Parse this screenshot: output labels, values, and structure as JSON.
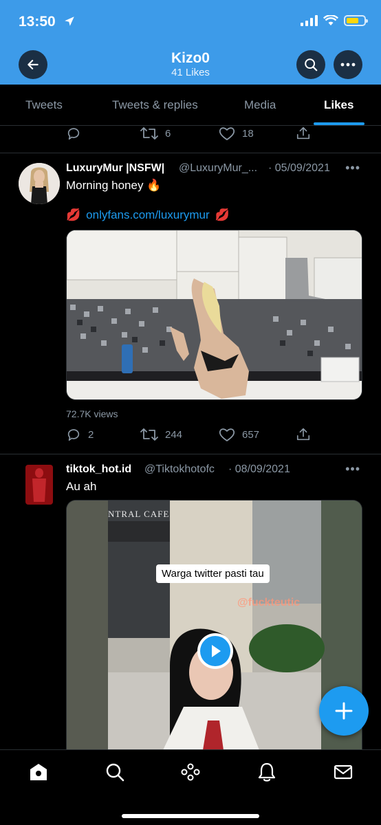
{
  "status": {
    "time": "13:50"
  },
  "header": {
    "title": "Kizo0",
    "subtitle": "41 Likes"
  },
  "tabs": [
    {
      "label": "Tweets"
    },
    {
      "label": "Tweets & replies"
    },
    {
      "label": "Media"
    },
    {
      "label": "Likes"
    }
  ],
  "prev_tweet": {
    "retweets": "6",
    "likes": "18"
  },
  "tweet1": {
    "name": "LuxuryMur |NSFW|",
    "handle": "@LuxuryMur_...",
    "date": "· 05/09/2021",
    "text": "Morning honey 🔥",
    "link": "onlyfans.com/luxurymur",
    "views": "72.7K views",
    "replies": "2",
    "retweets": "244",
    "likes": "657"
  },
  "tweet2": {
    "name": "tiktok_hot.id",
    "handle": "@Tiktokhotofc",
    "date": "· 08/09/2021",
    "text": "Au ah",
    "video_caption": "Warga twitter pasti tau",
    "video_watermark": "@fuckteutic",
    "video_sign": "NTRAL CAFE"
  },
  "colors": {
    "accent": "#1d9bf0",
    "header_bg": "#3d9be9",
    "battery": "#ffd60a"
  }
}
